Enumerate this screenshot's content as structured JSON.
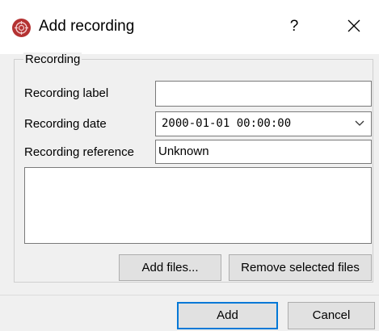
{
  "window": {
    "title": "Add recording",
    "help_label": "?"
  },
  "group": {
    "title": "Recording"
  },
  "fields": {
    "label": {
      "label": "Recording label",
      "value": ""
    },
    "date": {
      "label": "Recording date",
      "value": "2000-01-01 00:00:00"
    },
    "reference": {
      "label": "Recording reference",
      "value": "Unknown"
    }
  },
  "files": {
    "items": []
  },
  "buttons": {
    "add_files": "Add files...",
    "remove_files": "Remove selected files",
    "add": "Add",
    "cancel": "Cancel"
  },
  "icons": {
    "app": "app-logo-icon",
    "close": "close-icon",
    "dropdown": "chevron-down-icon"
  },
  "colors": {
    "accent": "#0078d7",
    "app_icon": "#b43232"
  }
}
